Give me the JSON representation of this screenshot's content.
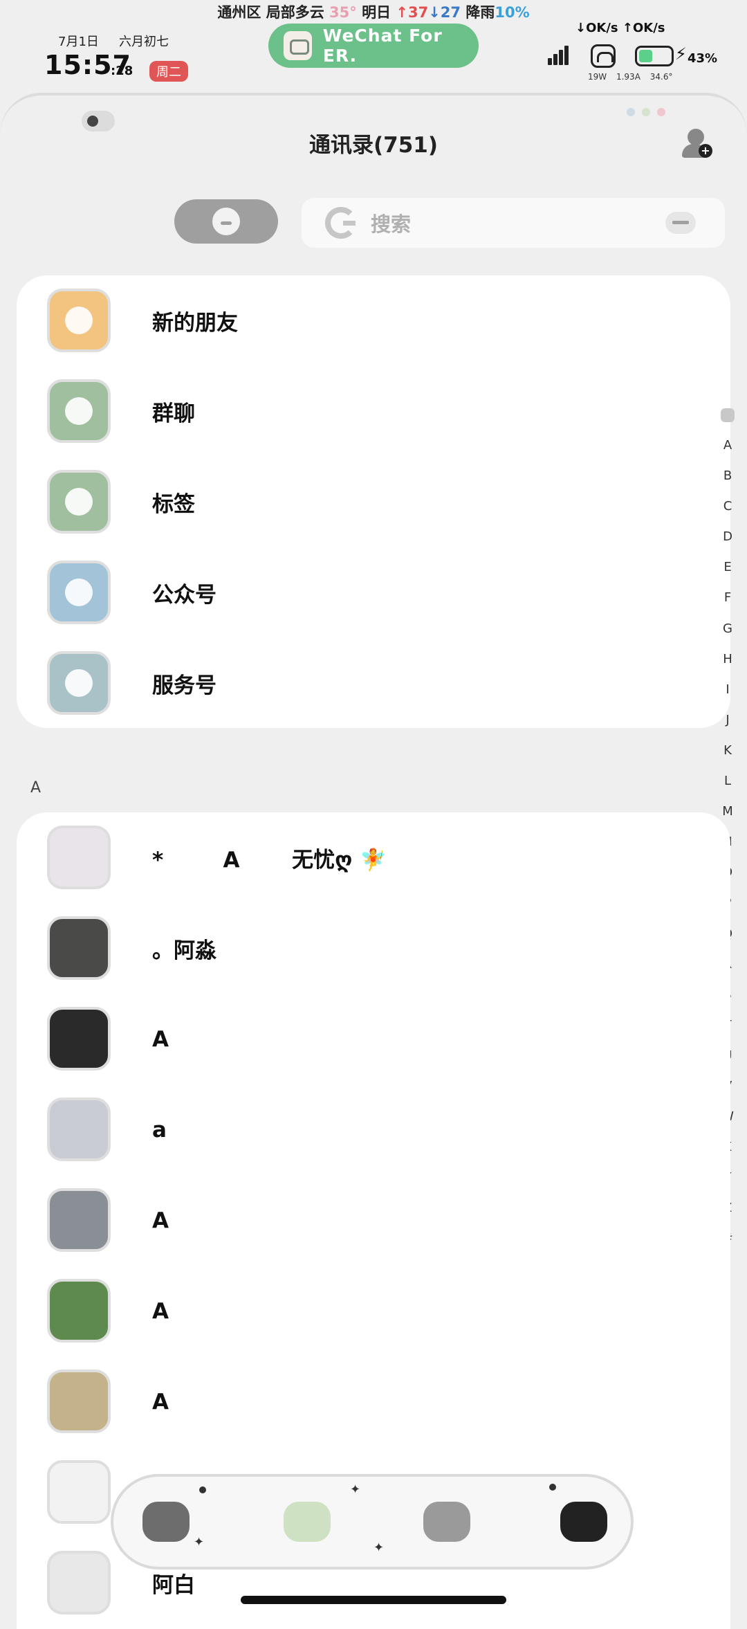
{
  "status": {
    "weather_loc": "通州区 局部多云",
    "weather_temp": "35°",
    "weather_tomorrow": "明日",
    "weather_hi": "↑37",
    "weather_lo": "↓27",
    "weather_rain": "降雨",
    "weather_rain_pct": "10%",
    "date": "7月1日",
    "lunar": "六月初七",
    "time": "15:57",
    "seconds": ":28",
    "weekday": "周二",
    "app_pill": "WeChat For ER.",
    "net_speed": "↓OK/s ↑OK/s",
    "battery": "43%",
    "battery_level": 0.43,
    "meta_power": "19W",
    "meta_current": "1.93A",
    "meta_temp": "34.6°"
  },
  "header": {
    "title": "通讯录(751)"
  },
  "search": {
    "placeholder": "搜索"
  },
  "functions": [
    {
      "label": "新的朋友",
      "color": "#f2c480",
      "icon": "new-friends-icon"
    },
    {
      "label": "群聊",
      "color": "#9fbf9e",
      "icon": "group-chat-icon"
    },
    {
      "label": "标签",
      "color": "#9fbf9e",
      "icon": "tag-icon"
    },
    {
      "label": "公众号",
      "color": "#a3c4d8",
      "icon": "official-account-icon"
    },
    {
      "label": "服务号",
      "color": "#a9c2c8",
      "icon": "service-account-icon"
    }
  ],
  "index_letters": [
    "A",
    "B",
    "C",
    "D",
    "E",
    "F",
    "G",
    "H",
    "I",
    "J",
    "K",
    "L",
    "M",
    "N",
    "O",
    "P",
    "Q",
    "R",
    "S",
    "T",
    "U",
    "V",
    "W",
    "X",
    "Y",
    "Z",
    "#"
  ],
  "section_letter": "A",
  "contacts": [
    {
      "name": "*        A       无忧ღ 🧚",
      "avatar": "#e9e3ea"
    },
    {
      "name": "。阿淼",
      "avatar": "#4a4a48"
    },
    {
      "name": "A",
      "avatar": "#2a2a2a"
    },
    {
      "name": "a",
      "avatar": "#c9ccd2"
    },
    {
      "name": "A",
      "avatar": "#8a8e95"
    },
    {
      "name": "A",
      "avatar": "#5f8a4e"
    },
    {
      "name": "A",
      "avatar": "#c4b28a"
    },
    {
      "name": "",
      "avatar": "#f2f2f2"
    },
    {
      "name": "阿白",
      "avatar": "#e8e8e8"
    }
  ],
  "bottom_nav": [
    {
      "name": "chats",
      "color": "#6d6d6d"
    },
    {
      "name": "contacts",
      "color": "#cfe1c3"
    },
    {
      "name": "discover",
      "color": "#9a9a9a"
    },
    {
      "name": "me",
      "color": "#222222"
    }
  ]
}
